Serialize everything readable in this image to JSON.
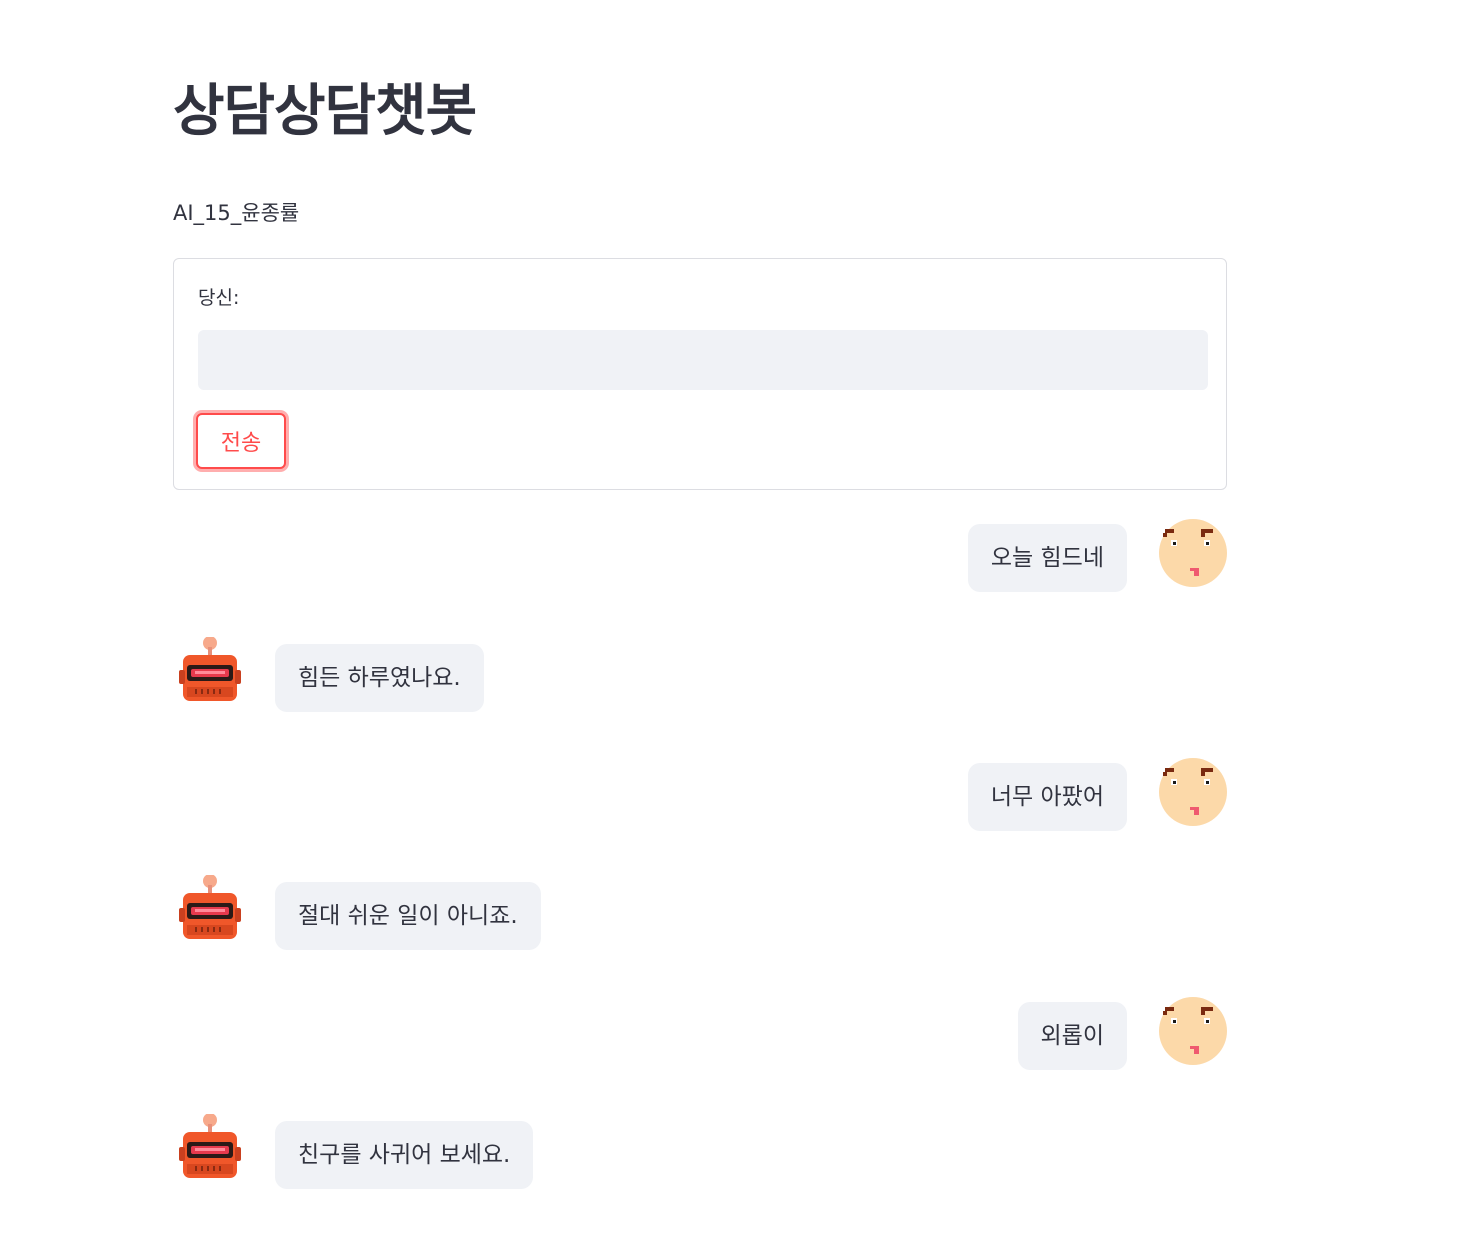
{
  "app": {
    "title": "상담상담챗봇",
    "subtitle": "AI_15_윤종률"
  },
  "form": {
    "input_label": "당신:",
    "input_value": "",
    "submit_label": "전송"
  },
  "messages": [
    {
      "role": "user",
      "text": "오늘 힘드네",
      "avatar": "user-face-icon"
    },
    {
      "role": "bot",
      "text": "힘든 하루였나요.",
      "avatar": "robot-icon"
    },
    {
      "role": "user",
      "text": "너무 아팠어",
      "avatar": "user-face-icon"
    },
    {
      "role": "bot",
      "text": "절대 쉬운 일이 아니죠.",
      "avatar": "robot-icon"
    },
    {
      "role": "user",
      "text": "외롭이",
      "avatar": "user-face-icon"
    },
    {
      "role": "bot",
      "text": "친구를 사귀어 보세요.",
      "avatar": "robot-icon"
    }
  ],
  "colors": {
    "accent": "#ff4b4b",
    "bubble_bg": "#f0f2f6",
    "text": "#31333f",
    "user_face": "#fcd9a9",
    "robot_body": "#f0572a"
  }
}
